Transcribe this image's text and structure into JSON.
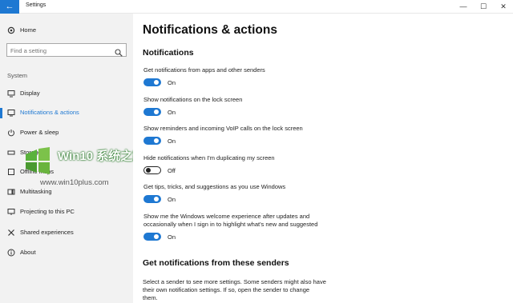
{
  "window": {
    "title": "Settings",
    "back_icon": "back-arrow-icon",
    "minimize": "—",
    "maximize": "☐",
    "close": "✕"
  },
  "sidebar": {
    "home_label": "Home",
    "search_placeholder": "Find a setting",
    "section_label": "System",
    "items": [
      {
        "label": "Display",
        "icon": "display-icon"
      },
      {
        "label": "Notifications & actions",
        "icon": "notifications-icon",
        "active": true
      },
      {
        "label": "Power & sleep",
        "icon": "power-icon"
      },
      {
        "label": "Storage",
        "icon": "storage-icon"
      },
      {
        "label": "Offline maps",
        "icon": "maps-icon"
      },
      {
        "label": "Multitasking",
        "icon": "multitasking-icon"
      },
      {
        "label": "Projecting to this PC",
        "icon": "projecting-icon"
      },
      {
        "label": "Shared experiences",
        "icon": "shared-experiences-icon"
      },
      {
        "label": "About",
        "icon": "info-icon"
      }
    ]
  },
  "watermark": {
    "title": "Win10 系统之家",
    "url": "www.win10plus.com"
  },
  "main": {
    "page_title": "Notifications & actions",
    "notifications_heading": "Notifications",
    "settings": [
      {
        "label": "Get notifications from apps and other senders",
        "state": "On"
      },
      {
        "label": "Show notifications on the lock screen",
        "state": "On"
      },
      {
        "label": "Show reminders and incoming VoIP calls on the lock screen",
        "state": "On"
      },
      {
        "label": "Hide notifications when I'm duplicating my screen",
        "state": "Off"
      },
      {
        "label": "Get tips, tricks, and suggestions as you use Windows",
        "state": "On"
      },
      {
        "label_line1": "Show me the Windows welcome experience after updates and",
        "label_line2": "occasionally when I sign in to highlight what's new and suggested",
        "state": "On"
      }
    ],
    "senders_heading": "Get notifications from these senders",
    "senders_desc": [
      "Select a sender to see more settings. Some senders might also have",
      "their own notification settings. If so, open the sender to change",
      "them."
    ]
  },
  "colors": {
    "accent": "#1e78d2",
    "sidebar_bg": "#f2f2f2"
  }
}
